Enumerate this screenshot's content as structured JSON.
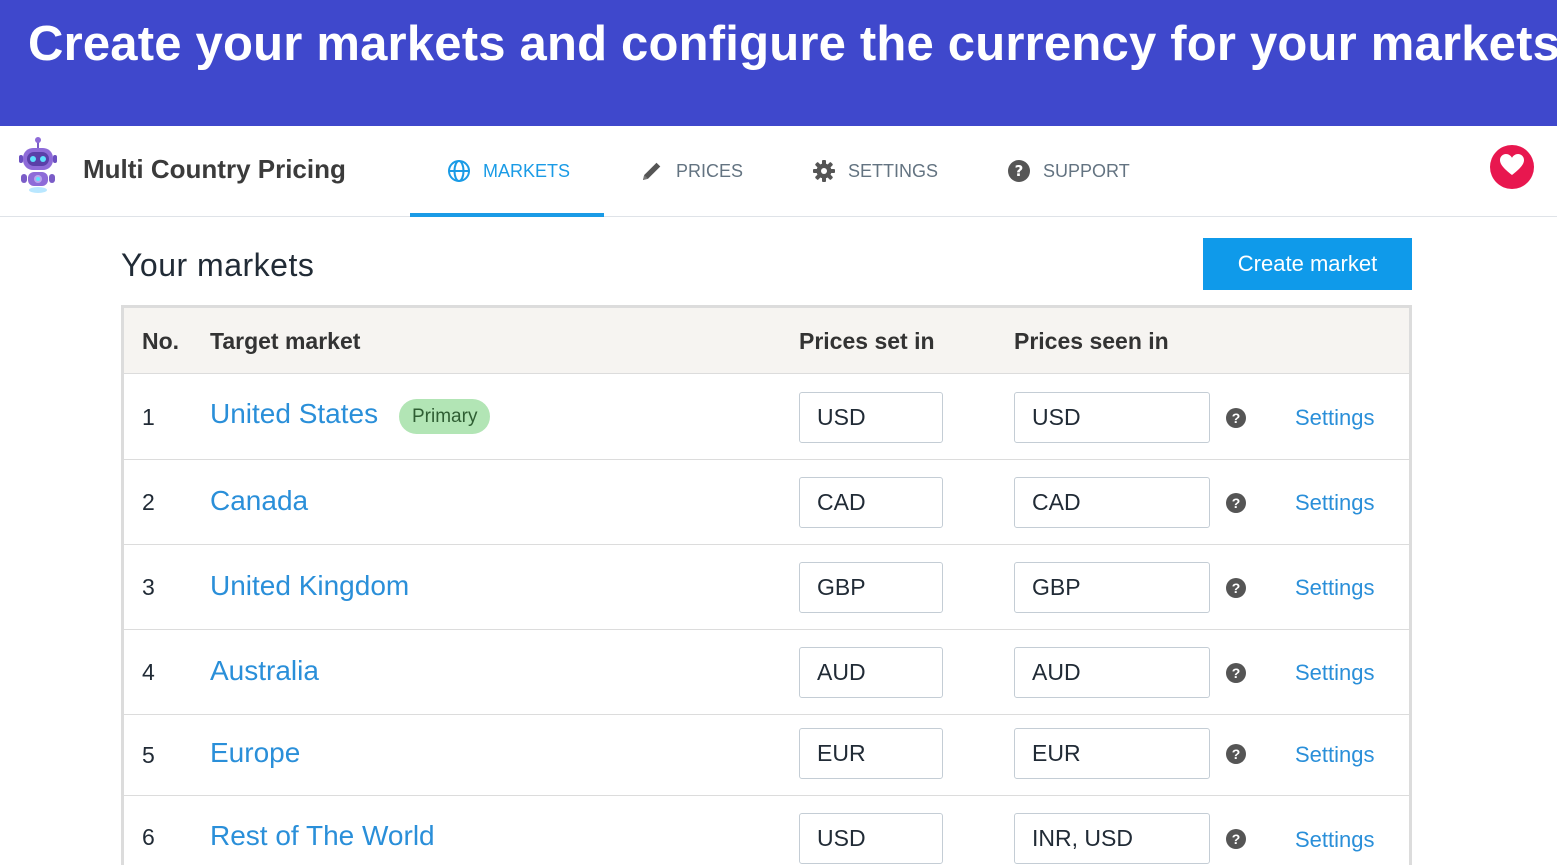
{
  "banner": {
    "text": "Create your markets and configure the currency for your markets"
  },
  "app": {
    "title": "Multi Country Pricing",
    "logo_icon": "robot-logo-icon"
  },
  "nav": {
    "tabs": [
      {
        "label": "MARKETS",
        "icon": "globe-icon",
        "active": true
      },
      {
        "label": "PRICES",
        "icon": "pencil-icon",
        "active": false
      },
      {
        "label": "SETTINGS",
        "icon": "gear-icon",
        "active": false
      },
      {
        "label": "SUPPORT",
        "icon": "question-circle-icon",
        "active": false
      }
    ],
    "favorite_icon": "heart-icon"
  },
  "main": {
    "heading": "Your markets",
    "create_button": "Create market",
    "table": {
      "headers": {
        "no": "No.",
        "market": "Target market",
        "set_in": "Prices set in",
        "seen_in": "Prices seen in"
      },
      "rows": [
        {
          "no": "1",
          "market": "United States",
          "badge": "Primary",
          "set_in": "USD",
          "seen_in": "USD",
          "settings": "Settings"
        },
        {
          "no": "2",
          "market": "Canada",
          "set_in": "CAD",
          "seen_in": "CAD",
          "settings": "Settings"
        },
        {
          "no": "3",
          "market": "United Kingdom",
          "set_in": "GBP",
          "seen_in": "GBP",
          "settings": "Settings"
        },
        {
          "no": "4",
          "market": "Australia",
          "set_in": "AUD",
          "seen_in": "AUD",
          "settings": "Settings"
        },
        {
          "no": "5",
          "market": "Europe",
          "set_in": "EUR",
          "seen_in": "EUR",
          "settings": "Settings"
        },
        {
          "no": "6",
          "market": "Rest of The World",
          "set_in": "USD",
          "seen_in": "INR, USD",
          "settings": "Settings"
        }
      ],
      "help_glyph": "?"
    }
  },
  "colors": {
    "banner": "#3f48cc",
    "accent": "#1a9be6",
    "link": "#2a8fd9",
    "badge_bg": "#b2e5b5",
    "heart": "#e8174f"
  }
}
